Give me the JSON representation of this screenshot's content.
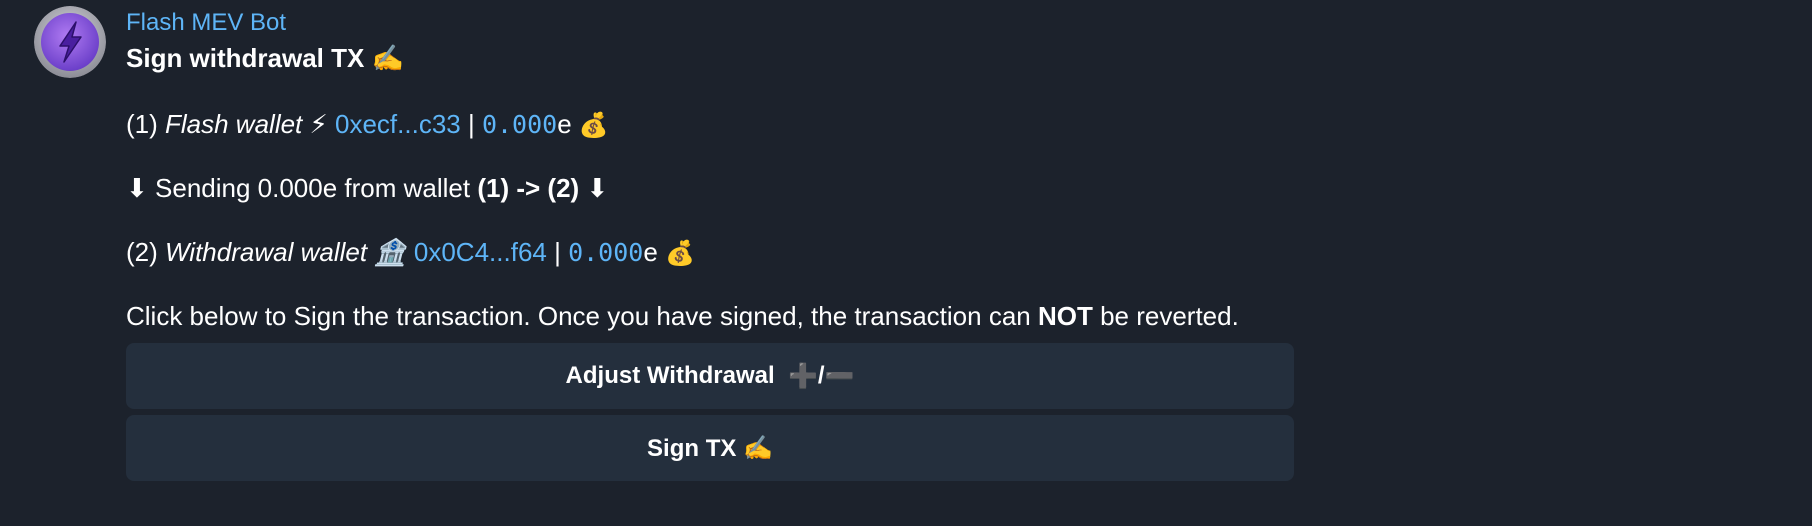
{
  "bot": {
    "name": "Flash MEV Bot",
    "avatar_icon": "lightning-bolt-icon",
    "accent": "#5eb5f7"
  },
  "message": {
    "title": "Sign withdrawal TX ✍️",
    "line1": {
      "prefix": "(1) ",
      "wallet_label": "Flash wallet ⚡",
      "address": "0xecf...c33",
      "separator": " | ",
      "amount": "0.000",
      "unit": "e",
      "icon": "💰"
    },
    "line2": {
      "arrow_left": "⬇",
      "text": " Sending 0.000e from wallet ",
      "route": "(1) -> (2)",
      "arrow_right": " ⬇"
    },
    "line3": {
      "prefix": "(2) ",
      "wallet_label": "Withdrawal wallet 🏦",
      "address": "0x0C4...f64",
      "separator": " | ",
      "amount": "0.000",
      "unit": "e",
      "icon": "💰"
    },
    "line4": {
      "before": "Click below to Sign the transaction. Once you have signed, the transaction can ",
      "emphasis": "NOT",
      "after": " be reverted."
    }
  },
  "buttons": {
    "adjust": {
      "label": "Adjust Withdrawal ",
      "plus": "➕",
      "slash": "/",
      "minus": "➖"
    },
    "sign": {
      "label": "Sign TX ✍️"
    }
  }
}
